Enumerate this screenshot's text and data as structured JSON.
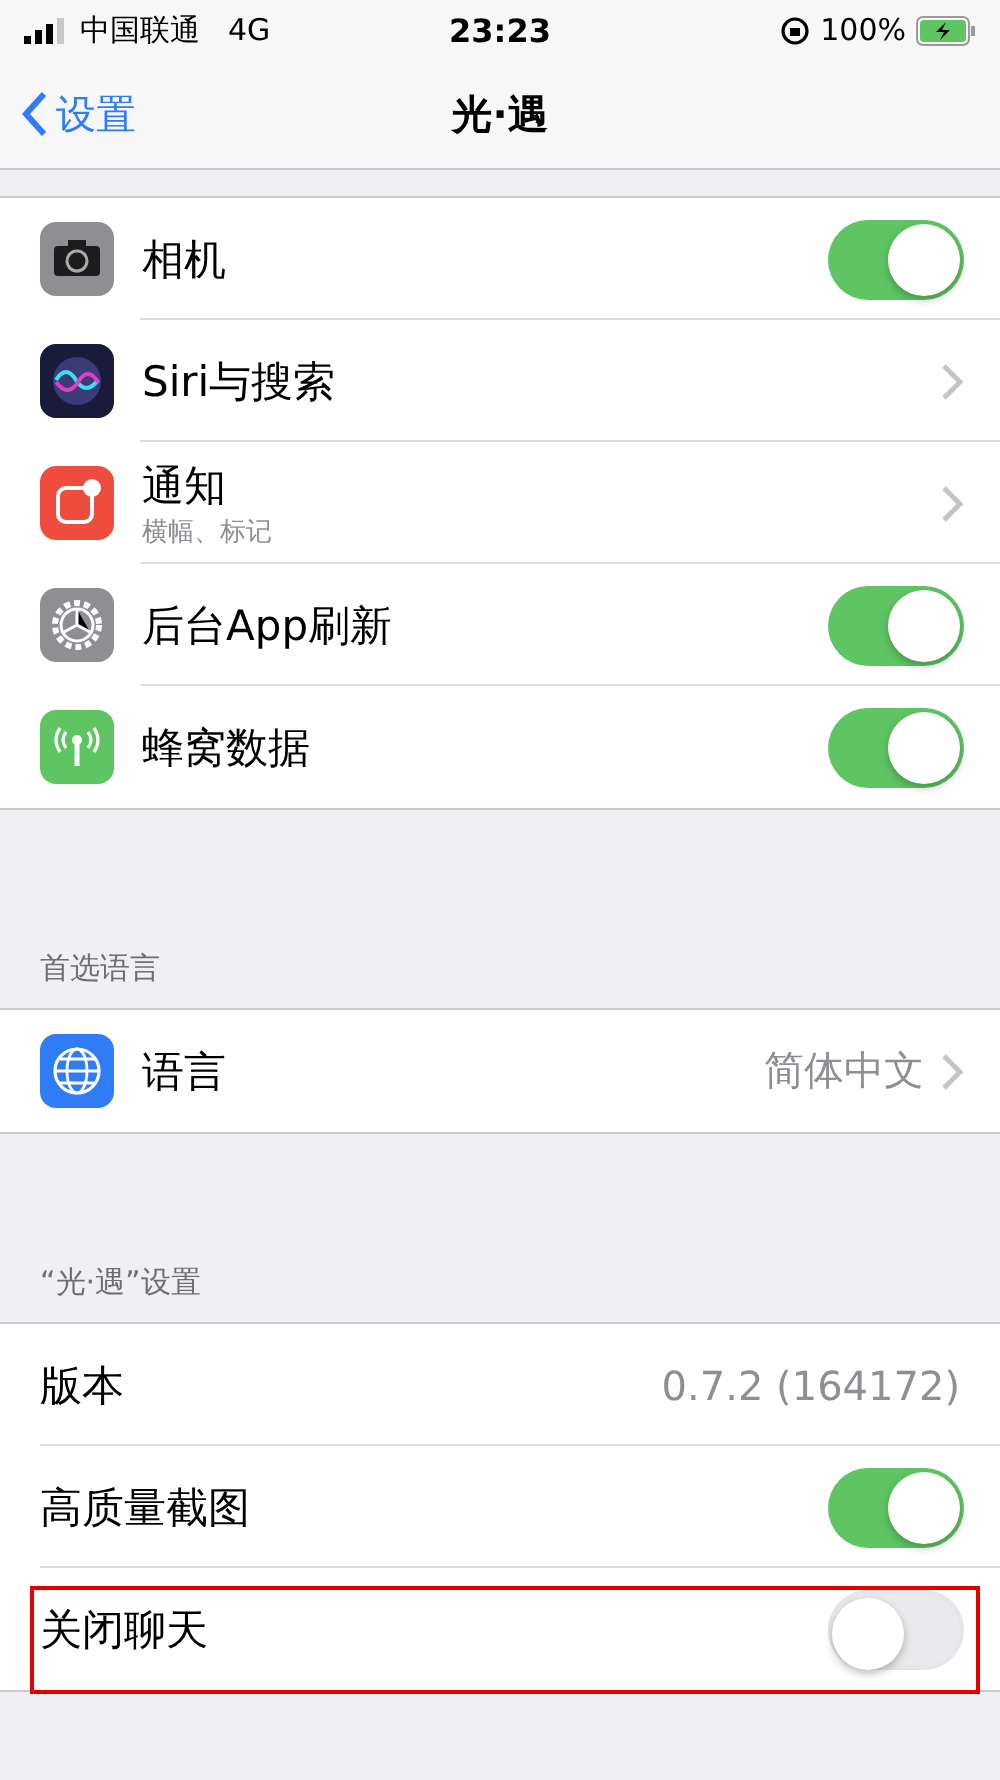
{
  "status_bar": {
    "carrier": "中国联通",
    "network": "4G",
    "time": "23:23",
    "battery": "100%"
  },
  "nav": {
    "back": "设置",
    "title": "光·遇"
  },
  "groups": [
    {
      "rows": [
        {
          "kind": "toggle",
          "title": "相机",
          "on": true
        },
        {
          "kind": "link",
          "title": "Siri与搜索"
        },
        {
          "kind": "link",
          "title": "通知",
          "subtitle": "横幅、标记"
        },
        {
          "kind": "toggle",
          "title": "后台App刷新",
          "on": true
        },
        {
          "kind": "toggle",
          "title": "蜂窝数据",
          "on": true
        }
      ]
    },
    {
      "header": "首选语言",
      "rows": [
        {
          "kind": "link",
          "title": "语言",
          "value": "简体中文"
        }
      ]
    },
    {
      "header": "“光·遇”设置",
      "rows": [
        {
          "kind": "value",
          "title": "版本",
          "value": "0.7.2 (164172)"
        },
        {
          "kind": "toggle",
          "title": "高质量截图",
          "on": true
        },
        {
          "kind": "toggle",
          "title": "关闭聊天",
          "on": false,
          "highlighted": true
        }
      ]
    }
  ]
}
